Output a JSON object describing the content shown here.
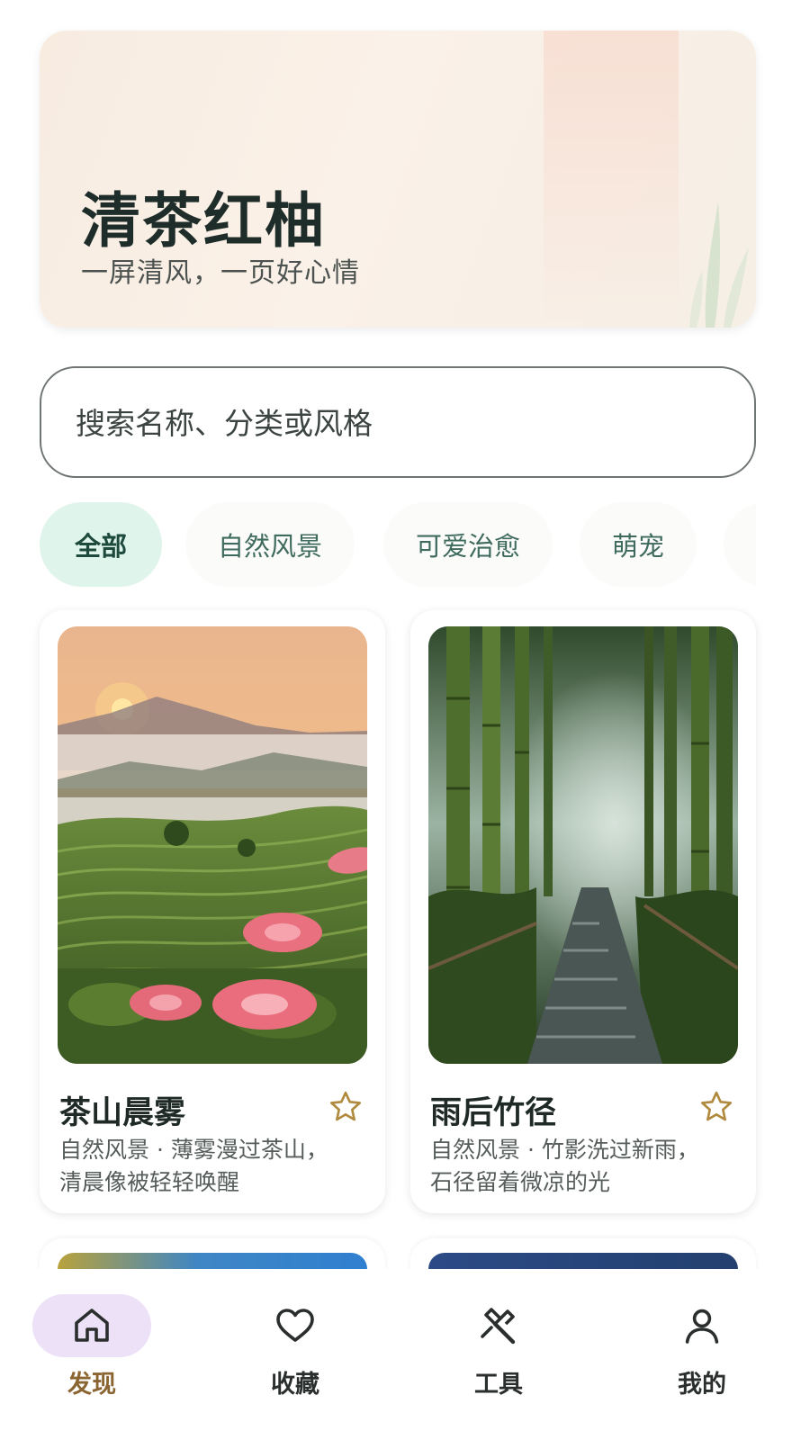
{
  "hero": {
    "title": "清茶红柚",
    "subtitle": "一屏清风，一页好心情"
  },
  "search": {
    "placeholder": "搜索名称、分类或风格"
  },
  "categories": {
    "active_index": 0,
    "items": [
      {
        "label": "全部"
      },
      {
        "label": "自然风景"
      },
      {
        "label": "可爱治愈"
      },
      {
        "label": "萌宠"
      }
    ]
  },
  "cards": [
    {
      "title": "茶山晨雾",
      "description": "自然风景 · 薄雾漫过茶山，清晨像被轻轻唤醒",
      "favorite_icon": "star-outline-icon"
    },
    {
      "title": "雨后竹径",
      "description": "自然风景 · 竹影洗过新雨，石径留着微凉的光",
      "favorite_icon": "star-outline-icon"
    }
  ],
  "bottom_nav": {
    "active_index": 0,
    "items": [
      {
        "label": "发现",
        "icon": "home-icon"
      },
      {
        "label": "收藏",
        "icon": "heart-icon"
      },
      {
        "label": "工具",
        "icon": "tools-icon"
      },
      {
        "label": "我的",
        "icon": "profile-icon"
      }
    ]
  },
  "colors": {
    "accent_active_chip": "#dff4ea",
    "accent_nav_pill": "#ece1f6",
    "nav_active_label": "#8a6532",
    "star": "#b08a3e"
  }
}
